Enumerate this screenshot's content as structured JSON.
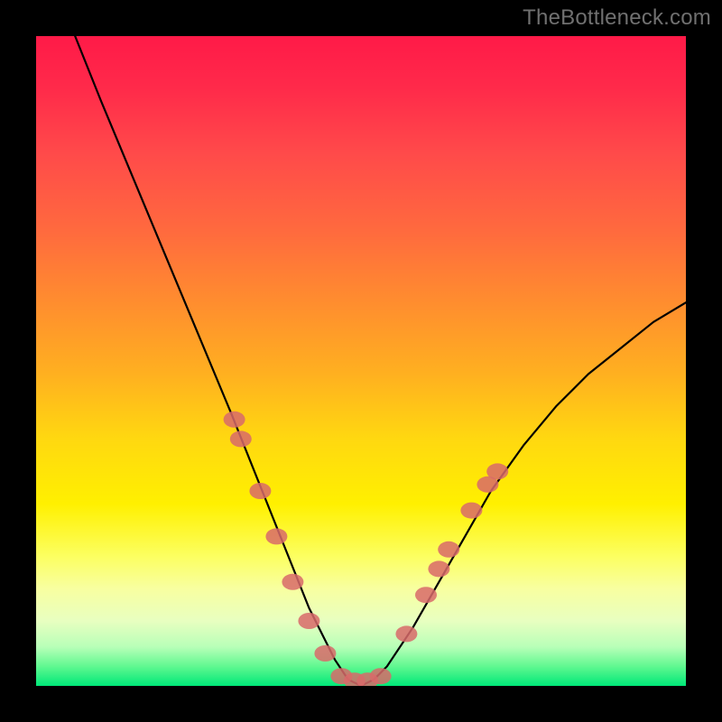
{
  "watermark": "TheBottleneck.com",
  "chart_data": {
    "type": "line",
    "title": "",
    "xlabel": "",
    "ylabel": "",
    "xlim": [
      0,
      100
    ],
    "ylim": [
      0,
      100
    ],
    "grid": false,
    "legend": false,
    "background": "red-yellow-green vertical gradient",
    "series": [
      {
        "name": "bottleneck-curve",
        "color": "#000000",
        "x": [
          6,
          10,
          15,
          20,
          25,
          30,
          34,
          38,
          42,
          46,
          48,
          50,
          52,
          54,
          58,
          62,
          66,
          70,
          75,
          80,
          85,
          90,
          95,
          100
        ],
        "values": [
          100,
          90,
          78,
          66,
          54,
          42,
          32,
          22,
          12,
          4,
          1,
          0,
          1,
          3,
          9,
          16,
          23,
          30,
          37,
          43,
          48,
          52,
          56,
          59
        ]
      }
    ],
    "markers": [
      {
        "name": "dots-left-branch",
        "color": "#d86a6a",
        "shape": "ellipse",
        "points": [
          {
            "x": 30.5,
            "y": 41
          },
          {
            "x": 31.5,
            "y": 38
          },
          {
            "x": 34.5,
            "y": 30
          },
          {
            "x": 37.0,
            "y": 23
          },
          {
            "x": 39.5,
            "y": 16
          },
          {
            "x": 42.0,
            "y": 10
          },
          {
            "x": 44.5,
            "y": 5
          }
        ]
      },
      {
        "name": "dots-valley-floor",
        "color": "#d86a6a",
        "shape": "ellipse",
        "points": [
          {
            "x": 47.0,
            "y": 1.5
          },
          {
            "x": 49.0,
            "y": 0.8
          },
          {
            "x": 51.0,
            "y": 0.8
          },
          {
            "x": 53.0,
            "y": 1.5
          }
        ]
      },
      {
        "name": "dots-right-branch",
        "color": "#d86a6a",
        "shape": "ellipse",
        "points": [
          {
            "x": 57.0,
            "y": 8
          },
          {
            "x": 60.0,
            "y": 14
          },
          {
            "x": 62.0,
            "y": 18
          },
          {
            "x": 63.5,
            "y": 21
          },
          {
            "x": 67.0,
            "y": 27
          },
          {
            "x": 69.5,
            "y": 31
          },
          {
            "x": 71.0,
            "y": 33
          }
        ]
      }
    ]
  }
}
